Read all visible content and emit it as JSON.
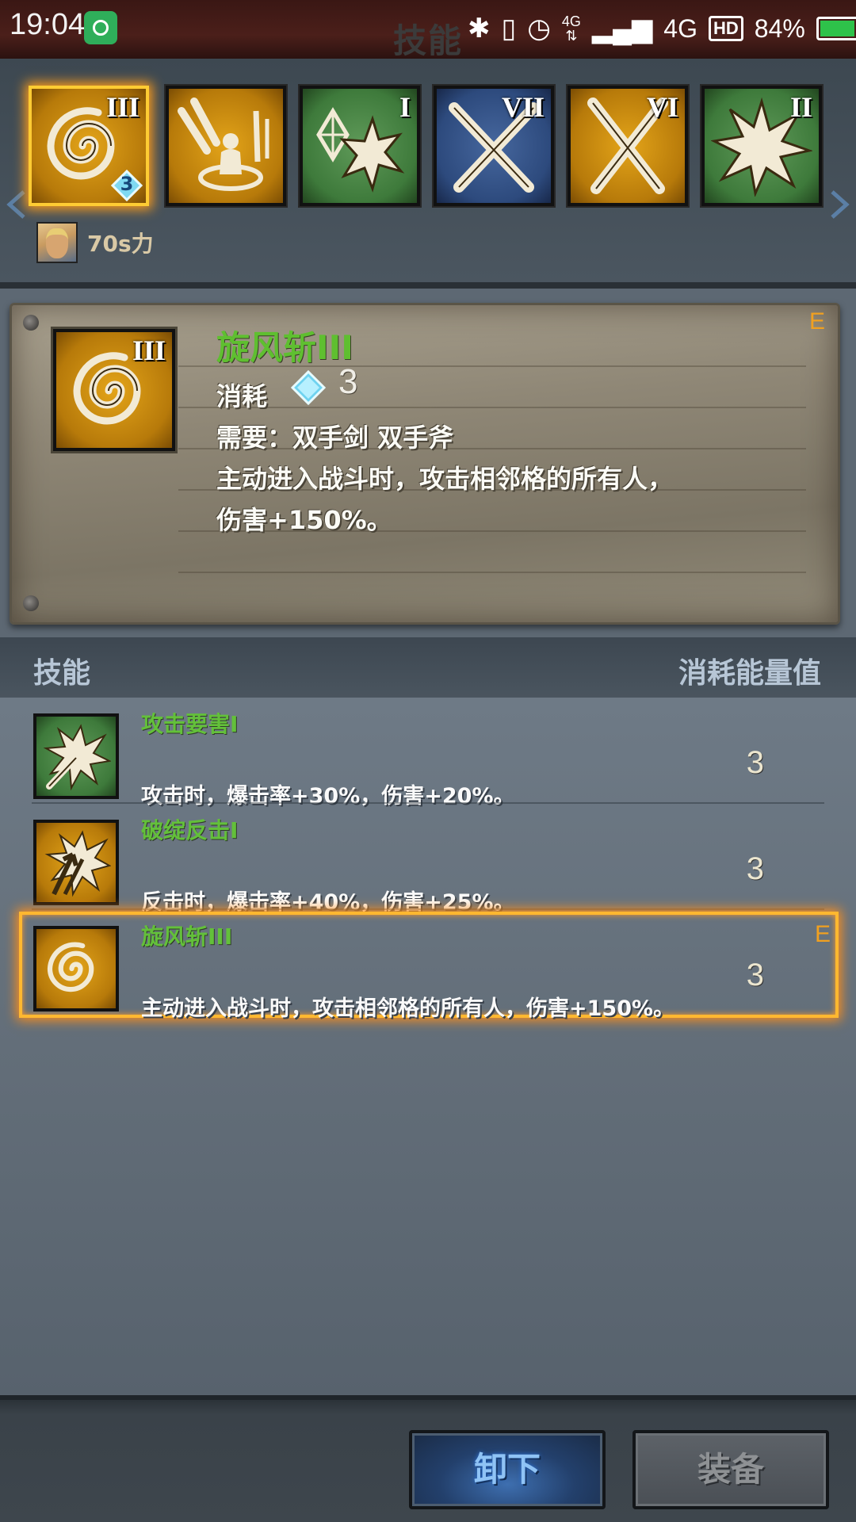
{
  "status_bar": {
    "time": "19:04",
    "network_type": "4G",
    "network_small": "4G",
    "hd_label": "HD",
    "battery_percent": "84%",
    "battery_level": 0.84,
    "icons": [
      "notification-app-icon",
      "bluetooth-icon",
      "vibrate-icon",
      "alarm-icon",
      "signal-icon",
      "battery-icon",
      "charging-icon"
    ]
  },
  "header": {
    "title": "技能"
  },
  "skill_strip": {
    "slots": [
      {
        "roman": "III",
        "color": "gold",
        "art": "whirlwind",
        "badge": "3",
        "selected": true
      },
      {
        "roman": "",
        "color": "gold",
        "art": "sword-summon",
        "badge": "",
        "selected": false
      },
      {
        "roman": "I",
        "color": "green",
        "art": "crystal-burst",
        "badge": "",
        "selected": false
      },
      {
        "roman": "VII",
        "color": "blue",
        "art": "crossed-swords",
        "badge": "",
        "selected": false
      },
      {
        "roman": "VI",
        "color": "gold",
        "art": "crossed-swords",
        "badge": "",
        "selected": false
      },
      {
        "roman": "II",
        "color": "green",
        "art": "burst",
        "badge": "",
        "selected": false
      }
    ],
    "hero_name": "70s力"
  },
  "detail": {
    "title": "旋风斩III",
    "grade": "E",
    "cost_label": "消耗",
    "cost_value": "3",
    "requirement": "需要：双手剑  双手斧",
    "description_line1": "主动进入战斗时，攻击相邻格的所有人，",
    "description_line2": "伤害+150%。"
  },
  "list_header": {
    "left": "技能",
    "right": "消耗能量值"
  },
  "skills": [
    {
      "name": "攻击要害I",
      "description": "攻击时，爆击率+30%，伤害+20%。",
      "cost": "3",
      "grade": "",
      "color": "green",
      "art": "sword-burst",
      "selected": false
    },
    {
      "name": "破绽反击I",
      "description": "反击时，爆击率+40%，伤害+25%。",
      "cost": "3",
      "grade": "",
      "color": "gold",
      "art": "arrow-burst",
      "selected": false
    },
    {
      "name": "旋风斩III",
      "description": "主动进入战斗时，攻击相邻格的所有人，伤害+150%。",
      "cost": "3",
      "grade": "E",
      "color": "gold",
      "art": "whirlwind",
      "selected": true
    }
  ],
  "buttons": {
    "unequip": "卸下",
    "equip": "装备"
  },
  "colors": {
    "skill_name_green": "#5fbf30",
    "grade_orange": "#f0a020",
    "selection_gold": "#ffb830"
  }
}
